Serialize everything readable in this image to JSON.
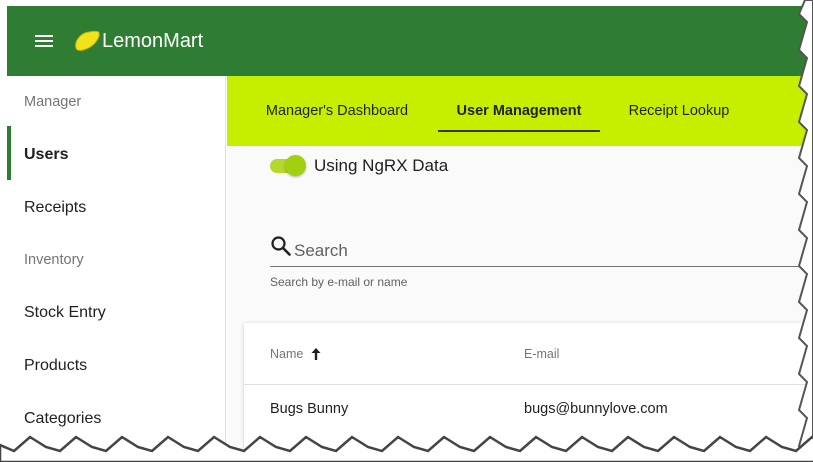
{
  "app": {
    "title": "LemonMart"
  },
  "toolbar": {
    "menu_icon": "menu-icon",
    "logo_icon": "lemon-icon",
    "color": "#2e7d32"
  },
  "sidebar": {
    "items": [
      {
        "label": "Manager",
        "type": "header"
      },
      {
        "label": "Users",
        "type": "link",
        "active": true
      },
      {
        "label": "Receipts",
        "type": "link"
      },
      {
        "label": "Inventory",
        "type": "header"
      },
      {
        "label": "Stock Entry",
        "type": "link"
      },
      {
        "label": "Products",
        "type": "link"
      },
      {
        "label": "Categories",
        "type": "link"
      }
    ]
  },
  "tabs": {
    "items": [
      {
        "label": "Manager's Dashboard"
      },
      {
        "label": "User Management",
        "active": true
      },
      {
        "label": "Receipt Lookup"
      }
    ],
    "background": "#c6ef00"
  },
  "toggle": {
    "label": "Using NgRX Data",
    "on": true
  },
  "search": {
    "placeholder": "Search",
    "value": "",
    "hint": "Search by e-mail or name",
    "icon": "search-icon"
  },
  "table": {
    "columns": [
      {
        "label": "Name",
        "sort": "ascending"
      },
      {
        "label": "E-mail"
      }
    ],
    "rows": [
      {
        "name": "Bugs Bunny",
        "email": "bugs@bunnylove.com"
      }
    ]
  }
}
